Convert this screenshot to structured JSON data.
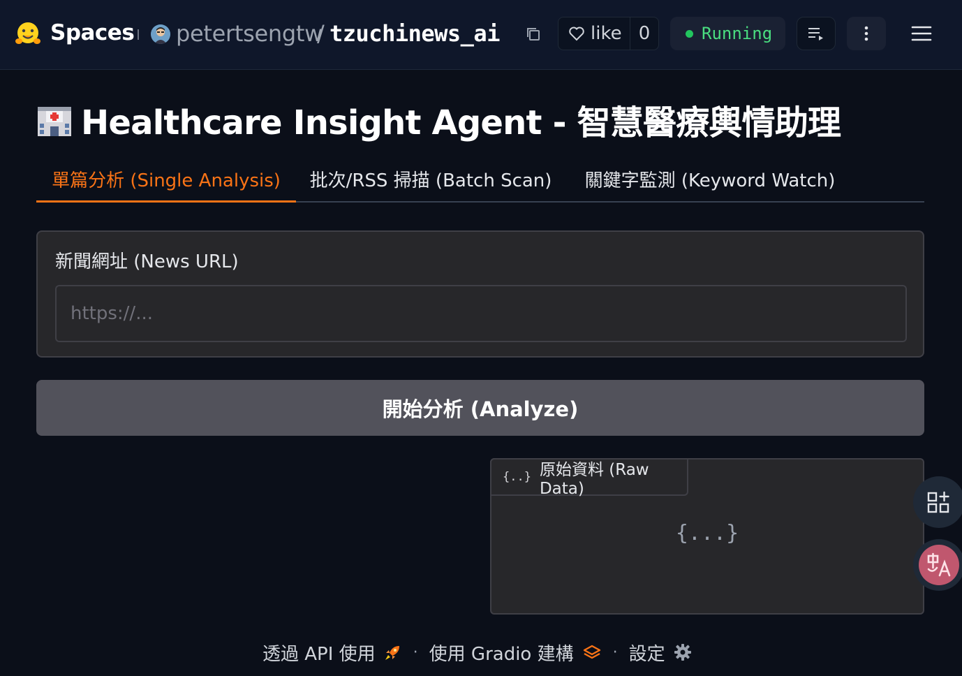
{
  "hf_bar": {
    "spaces_label": "Spaces",
    "owner": "petertsengtw",
    "separator": "/",
    "repo": "tzuchinews_ai",
    "like_label": "like",
    "like_count": "0",
    "status": "Running",
    "colors": {
      "status": "#22c55e",
      "accent": "#f97316"
    }
  },
  "app": {
    "title": "Healthcare Insight Agent - 智慧醫療輿情助理",
    "title_icon": "hospital-icon",
    "tabs": [
      {
        "label": "單篇分析 (Single Analysis)",
        "active": true
      },
      {
        "label": "批次/RSS 掃描 (Batch Scan)",
        "active": false
      },
      {
        "label": "關鍵字監測 (Keyword Watch)",
        "active": false
      }
    ],
    "url_label": "新聞網址 (News URL)",
    "url_placeholder": "https://...",
    "url_value": "",
    "analyze_label": "開始分析 (Analyze)",
    "raw_tab_label": "原始資料 (Raw Data)",
    "raw_empty": "{...}",
    "raw_tab_icon": "{..}"
  },
  "footer": {
    "api_label": "透過 API 使用",
    "built_label": "使用 Gradio 建構",
    "settings_label": "設定",
    "separator": "·"
  }
}
